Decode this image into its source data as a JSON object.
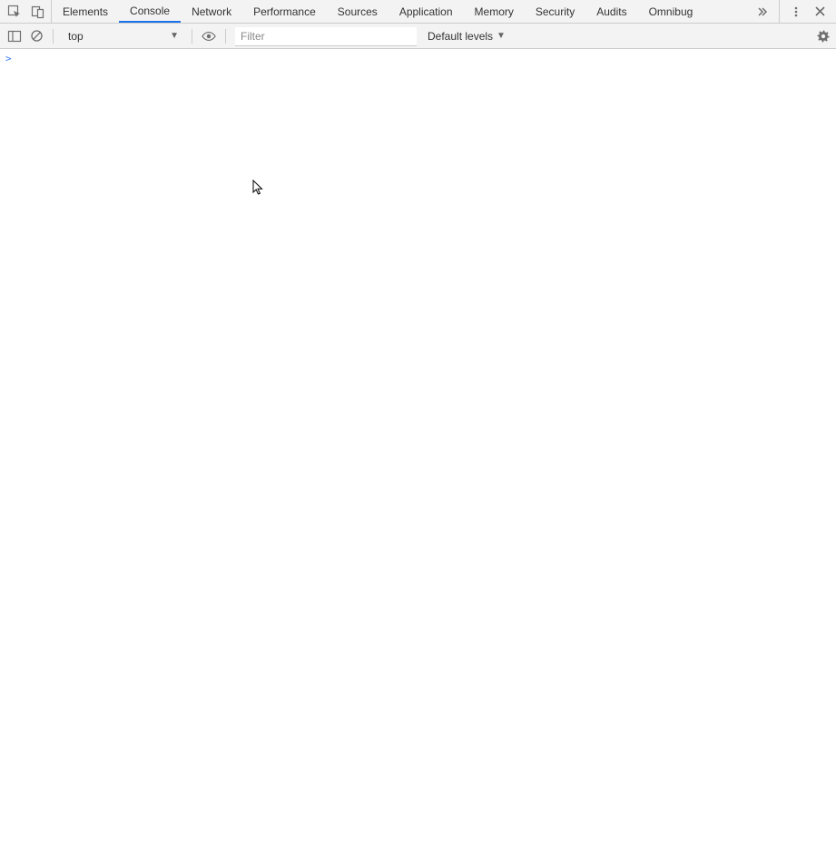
{
  "tabs": [
    {
      "label": "Elements"
    },
    {
      "label": "Console"
    },
    {
      "label": "Network"
    },
    {
      "label": "Performance"
    },
    {
      "label": "Sources"
    },
    {
      "label": "Application"
    },
    {
      "label": "Memory"
    },
    {
      "label": "Security"
    },
    {
      "label": "Audits"
    },
    {
      "label": "Omnibug"
    }
  ],
  "active_tab_index": 1,
  "toolbar": {
    "context": "top",
    "filter_placeholder": "Filter",
    "levels_label": "Default levels"
  },
  "console": {
    "prompt": ">"
  }
}
